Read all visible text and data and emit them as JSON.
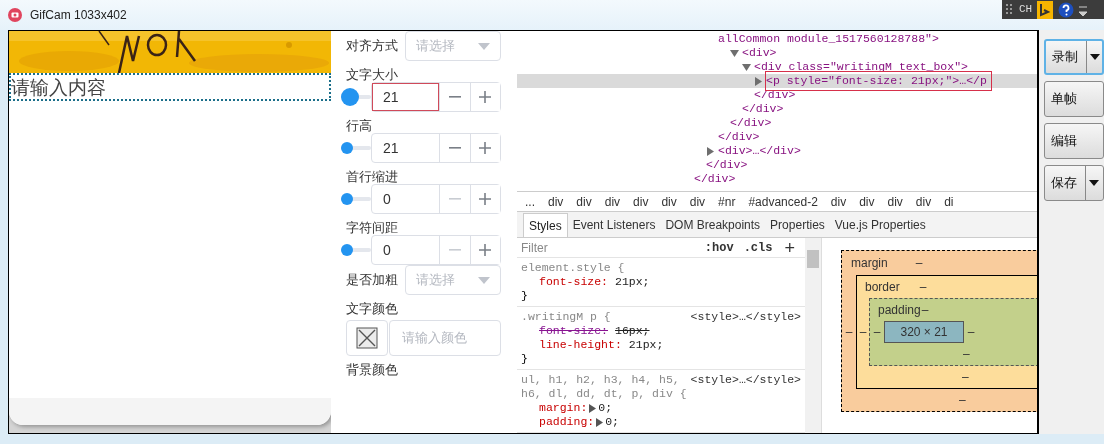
{
  "window": {
    "title": "GifCam 1033x402"
  },
  "tray": {
    "language": "CH"
  },
  "preview": {
    "text_placeholder": "请输入内容"
  },
  "form": {
    "fields": [
      {
        "kind": "select",
        "label": "对齐方式",
        "placeholder": "请选择"
      },
      {
        "kind": "label",
        "label": "文字大小"
      },
      {
        "kind": "number",
        "value": "21",
        "level": 0,
        "active": true,
        "focused": true,
        "minus_disabled": false
      },
      {
        "kind": "label",
        "label": "行高"
      },
      {
        "kind": "number",
        "value": "21",
        "level": 0,
        "active": false,
        "focused": false,
        "minus_disabled": false
      },
      {
        "kind": "label",
        "label": "首行缩进"
      },
      {
        "kind": "number",
        "value": "0",
        "level": 0,
        "active": false,
        "focused": false,
        "minus_disabled": true
      },
      {
        "kind": "label",
        "label": "字符间距"
      },
      {
        "kind": "number",
        "value": "0",
        "level": 0,
        "active": false,
        "focused": false,
        "minus_disabled": true
      },
      {
        "kind": "select",
        "label": "是否加粗",
        "placeholder": "请选择"
      },
      {
        "kind": "label",
        "label": "文字颜色"
      },
      {
        "kind": "color",
        "placeholder": "请输入颜色"
      },
      {
        "kind": "label",
        "label": "背景颜色"
      }
    ]
  },
  "devtools": {
    "dom_tree": [
      {
        "close": "</div>",
        "children": [
          {
            "close": "</div>",
            "children": [
              {
                "close": "</div>",
                "children": [
                  {
                    "text": "allCommon module_1517560128788\">",
                    "kind": "continuation",
                    "close": "</div>",
                    "children": [
                      {
                        "text": "<div>",
                        "expanded": true,
                        "close": "</div>",
                        "children": [
                          {
                            "text": "<div class=\"writingM text_box\">",
                            "expanded": true,
                            "close": "</div>",
                            "children": [
                              {
                                "text": "<p style=\"font-size: 21px;\">…</p",
                                "expanded": false,
                                "selected": true
                              }
                            ]
                          }
                        ]
                      }
                    ]
                  }
                ]
              },
              {
                "text": "<div>…</div>",
                "expanded": false
              }
            ]
          }
        ]
      }
    ],
    "breadcrumbs": [
      "...",
      "div",
      "div",
      "div",
      "div",
      "div",
      "div",
      "#nr",
      "#advanced-2",
      "div",
      "div",
      "div",
      "div",
      "di"
    ],
    "tabs": [
      {
        "label": "Styles",
        "selected": true
      },
      {
        "label": "Event Listeners",
        "selected": false
      },
      {
        "label": "DOM Breakpoints",
        "selected": false
      },
      {
        "label": "Properties",
        "selected": false
      },
      {
        "label": "Vue.js Properties",
        "selected": false
      }
    ],
    "filter": {
      "placeholder": "Filter",
      "hov": ":hov",
      "cls": ".cls",
      "add": "+"
    },
    "rules": [
      {
        "selector": [
          "element.style {"
        ],
        "declarations": [
          {
            "property": "font-size:",
            "value": "21px;",
            "struck": false,
            "expandable": false
          }
        ],
        "close": "}"
      },
      {
        "selector": [
          ".writingM p {"
        ],
        "source": "<style>…</style>",
        "declarations": [
          {
            "property": "font-size:",
            "value": "16px;",
            "struck": true,
            "expandable": false
          },
          {
            "property": "line-height:",
            "value": "21px;",
            "struck": false,
            "expandable": false
          }
        ],
        "close": "}"
      },
      {
        "selector": [
          "ul, h1, h2, h3, h4, h5,",
          "h6, dl, dd, dt, p, div {"
        ],
        "source": "<style>…</style>",
        "declarations": [
          {
            "property": "margin:",
            "value": "0;",
            "struck": false,
            "expandable": true
          },
          {
            "property": "padding:",
            "value": "0;",
            "struck": false,
            "expandable": true
          }
        ]
      }
    ],
    "box_model": {
      "margin": {
        "label": "margin",
        "top": "–",
        "left": "–",
        "bottom": "–"
      },
      "border": {
        "label": "border",
        "top": "–",
        "left": "–",
        "bottom": "–"
      },
      "padding": {
        "label": "padding",
        "top": "–",
        "left": "–",
        "right": "–",
        "bottom": "–"
      },
      "content": "320 × 21"
    }
  },
  "gifcam_buttons": [
    {
      "label": "录制",
      "has_menu": true,
      "selected": true
    },
    {
      "label": "单帧",
      "has_menu": false,
      "selected": false
    },
    {
      "label": "编辑",
      "has_menu": false,
      "selected": false
    },
    {
      "label": "保存",
      "has_menu": true,
      "selected": false
    }
  ]
}
